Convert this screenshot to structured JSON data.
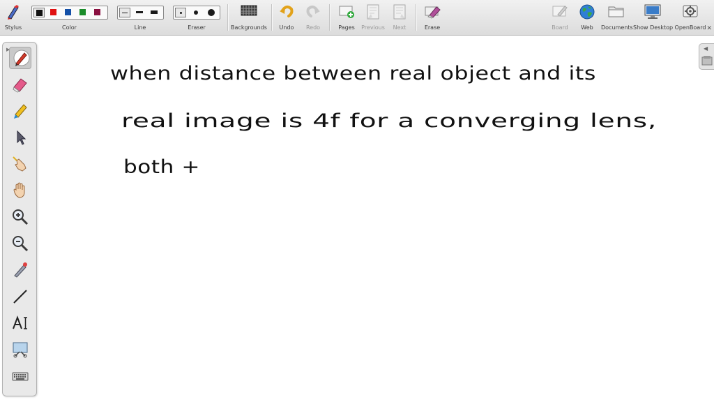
{
  "toolbar": {
    "stylus": "Stylus",
    "color": "Color",
    "line": "Line",
    "eraser": "Eraser",
    "backgrounds": "Backgrounds",
    "undo": "Undo",
    "redo": "Redo",
    "pages": "Pages",
    "previous": "Previous",
    "next": "Next",
    "erase": "Erase",
    "board": "Board",
    "web": "Web",
    "documents": "Documents",
    "show_desktop": "Show Desktop",
    "openboard": "OpenBoard"
  },
  "colors": [
    "#111111",
    "#e01010",
    "#1450a8",
    "#1a8c2a",
    "#8a1040"
  ],
  "selected_color_index": 0,
  "selected_line_index": 0,
  "selected_eraser_index": 0,
  "canvas_text": {
    "line1": "when distance between real object and its",
    "line2": "real image is 4f for a converging lens,",
    "line3": "both +"
  },
  "icons": {
    "stylus": "stylus-icon",
    "backgrounds": "backgrounds-icon",
    "undo": "undo-icon",
    "redo": "redo-icon",
    "pages": "pages-icon",
    "previous": "previous-page-icon",
    "next": "next-page-icon",
    "erase": "erase-icon",
    "board": "board-icon",
    "web": "globe-icon",
    "documents": "folder-icon",
    "show_desktop": "monitor-icon",
    "openboard": "openboard-icon"
  }
}
